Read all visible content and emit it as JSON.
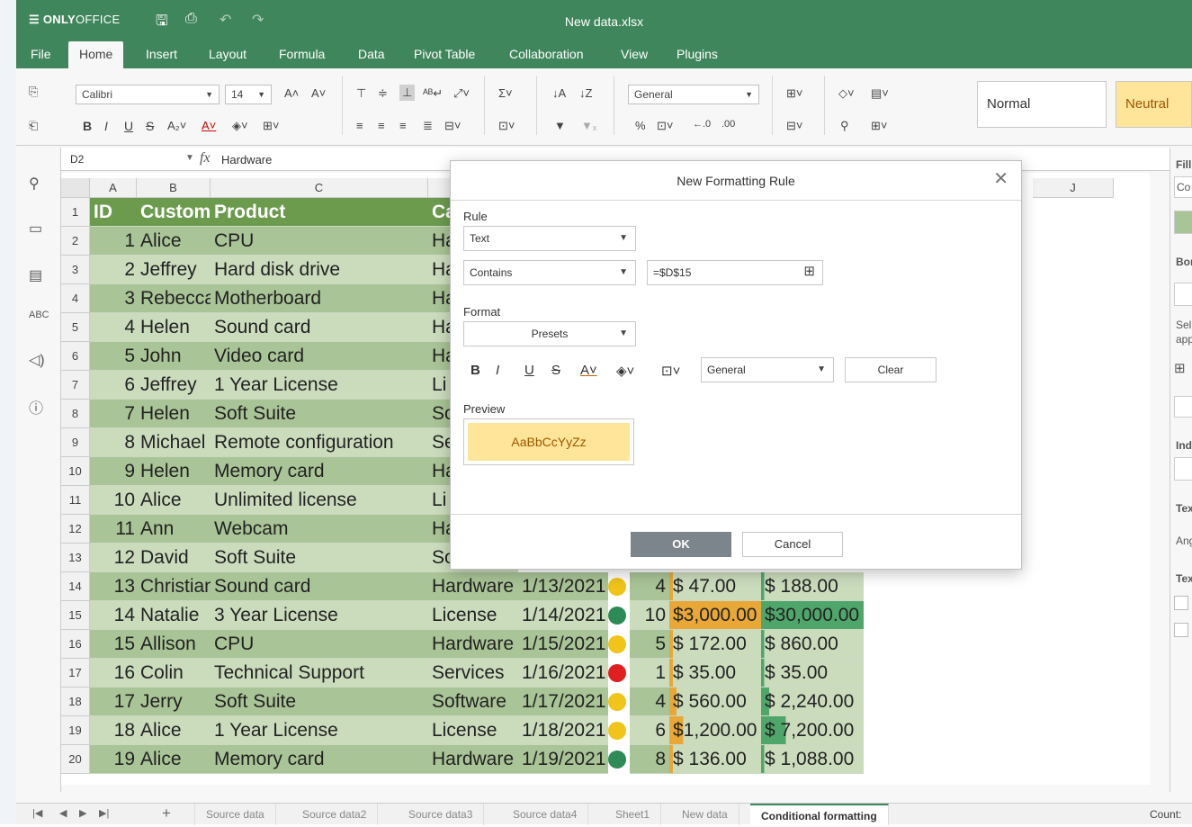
{
  "app": {
    "logo_bold": "ONLY",
    "logo_rest": "OFFICE",
    "doc_title": "New data.xlsx"
  },
  "menu": [
    "File",
    "Home",
    "Insert",
    "Layout",
    "Formula",
    "Data",
    "Pivot Table",
    "Collaboration",
    "View",
    "Plugins"
  ],
  "toolbar": {
    "font_name": "Calibri",
    "font_size": "14",
    "number_format": "General",
    "style_normal": "Normal",
    "style_neutral": "Neutral"
  },
  "formula": {
    "cell_ref": "D2",
    "fx": "fx",
    "value": "Hardware"
  },
  "columns": [
    "A",
    "B",
    "C",
    "J"
  ],
  "header_row": {
    "id": "ID",
    "customer": "Customer",
    "product": "Product",
    "category": "Ca"
  },
  "rows": [
    {
      "n": "2",
      "id": "1",
      "cust": "Alice",
      "prod": "CPU",
      "cat": "Ha",
      "date": "",
      "qty": "",
      "price": "",
      "total": "",
      "dot": ""
    },
    {
      "n": "3",
      "id": "2",
      "cust": "Jeffrey",
      "prod": "Hard disk drive",
      "cat": "Ha",
      "date": "",
      "qty": "",
      "price": "",
      "total": "",
      "dot": ""
    },
    {
      "n": "4",
      "id": "3",
      "cust": "Rebecca",
      "prod": "Motherboard",
      "cat": "Ha",
      "date": "",
      "qty": "",
      "price": "",
      "total": "",
      "dot": ""
    },
    {
      "n": "5",
      "id": "4",
      "cust": "Helen",
      "prod": "Sound card",
      "cat": "Ha",
      "date": "",
      "qty": "",
      "price": "",
      "total": "",
      "dot": ""
    },
    {
      "n": "6",
      "id": "5",
      "cust": "John",
      "prod": "Video card",
      "cat": "Ha",
      "date": "",
      "qty": "",
      "price": "",
      "total": "",
      "dot": ""
    },
    {
      "n": "7",
      "id": "6",
      "cust": "Jeffrey",
      "prod": "1 Year License",
      "cat": "Li",
      "date": "",
      "qty": "",
      "price": "",
      "total": "",
      "dot": ""
    },
    {
      "n": "8",
      "id": "7",
      "cust": "Helen",
      "prod": "Soft Suite",
      "cat": "So",
      "date": "",
      "qty": "",
      "price": "",
      "total": "",
      "dot": ""
    },
    {
      "n": "9",
      "id": "8",
      "cust": "Michael",
      "prod": "Remote configuration",
      "cat": "Se",
      "date": "",
      "qty": "",
      "price": "",
      "total": "",
      "dot": ""
    },
    {
      "n": "10",
      "id": "9",
      "cust": "Helen",
      "prod": "Memory card",
      "cat": "Ha",
      "date": "",
      "qty": "",
      "price": "",
      "total": "",
      "dot": ""
    },
    {
      "n": "11",
      "id": "10",
      "cust": "Alice",
      "prod": "Unlimited license",
      "cat": "Li",
      "date": "",
      "qty": "",
      "price": "",
      "total": "",
      "dot": ""
    },
    {
      "n": "12",
      "id": "11",
      "cust": "Ann",
      "prod": "Webcam",
      "cat": "Ha",
      "date": "",
      "qty": "",
      "price": "",
      "total": "",
      "dot": ""
    },
    {
      "n": "13",
      "id": "12",
      "cust": "David",
      "prod": "Soft Suite",
      "cat": "So",
      "date": "",
      "qty": "",
      "price": "",
      "total": "",
      "dot": ""
    },
    {
      "n": "14",
      "id": "13",
      "cust": "Christian",
      "prod": "Sound card",
      "cat": "Hardware",
      "date": "1/13/2021",
      "qty": "4",
      "price": "$    47.00",
      "total": "$    188.00",
      "dot": "#f0c419"
    },
    {
      "n": "15",
      "id": "14",
      "cust": "Natalie",
      "prod": "3 Year License",
      "cat": "License",
      "date": "1/14/2021",
      "qty": "10",
      "price": "$3,000.00",
      "total": "$30,000.00",
      "dot": "#2e8b57"
    },
    {
      "n": "16",
      "id": "15",
      "cust": "Allison",
      "prod": "CPU",
      "cat": "Hardware",
      "date": "1/15/2021",
      "qty": "5",
      "price": "$  172.00",
      "total": "$    860.00",
      "dot": "#f0c419"
    },
    {
      "n": "17",
      "id": "16",
      "cust": "Colin",
      "prod": "Technical Support",
      "cat": "Services",
      "date": "1/16/2021",
      "qty": "1",
      "price": "$    35.00",
      "total": "$      35.00",
      "dot": "#e02020"
    },
    {
      "n": "18",
      "id": "17",
      "cust": "Jerry",
      "prod": "Soft Suite",
      "cat": "Software",
      "date": "1/17/2021",
      "qty": "4",
      "price": "$  560.00",
      "total": "$ 2,240.00",
      "dot": "#f0c419"
    },
    {
      "n": "19",
      "id": "18",
      "cust": "Alice",
      "prod": "1 Year License",
      "cat": "License",
      "date": "1/18/2021",
      "qty": "6",
      "price": "$1,200.00",
      "total": "$ 7,200.00",
      "dot": "#f0c419"
    },
    {
      "n": "20",
      "id": "19",
      "cust": "Alice",
      "prod": "Memory card",
      "cat": "Hardware",
      "date": "1/19/2021",
      "qty": "8",
      "price": "$  136.00",
      "total": "$ 1,088.00",
      "dot": "#2e8b57"
    }
  ],
  "rightpanel": [
    "Fill",
    "Co",
    "Bor",
    "Sel",
    "app",
    "Ind",
    "Tex",
    "Ang",
    "Tex"
  ],
  "dialog": {
    "title": "New Formatting Rule",
    "rule_label": "Rule",
    "rule_type": "Text",
    "condition": "Contains",
    "value": "=$D$15",
    "format_label": "Format",
    "presets": "Presets",
    "number_format": "General",
    "clear": "Clear",
    "preview_label": "Preview",
    "preview_text": "AaBbCcYyZz",
    "ok": "OK",
    "cancel": "Cancel"
  },
  "sheets": [
    "Source data",
    "Source data2",
    "Source data3",
    "Source data4",
    "Sheet1",
    "New data",
    "Conditional formatting"
  ],
  "status": "Count:"
}
